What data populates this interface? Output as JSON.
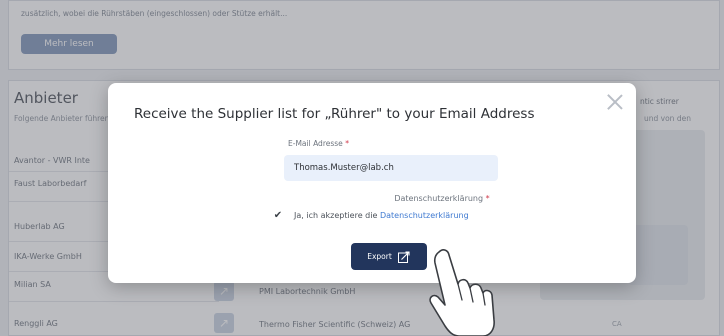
{
  "background": {
    "description_snippet": "zusätzlich, wobei die Rührstäben (eingeschlossen) oder Stütze erhält...",
    "more_button": "Mehr lesen",
    "section_title": "Anbieter",
    "section_subtitle": "Folgende Anbieter führen",
    "right_subtitle": "und von den",
    "right_text": "ntic stirrer",
    "card_caption": "CA",
    "suppliers": [
      "Avantor - VWR Inte",
      "Faust Laborbedarf",
      "Huberlab AG",
      "IKA-Werke GmbH",
      "Milian SA",
      "Renggli AG"
    ],
    "mid_suppliers": [
      "PMI Labortechnik GmbH",
      "Thermo Fisher Scientific (Schweiz) AG"
    ]
  },
  "modal": {
    "title": "Receive the Supplier list for „Rührer\" to your Email Address",
    "email_label": "E-Mail Adresse",
    "required_mark": "*",
    "email_value": "Thomas.Muster@lab.ch",
    "privacy_label": "Datenschutzerklärung",
    "consent_prefix": "Ja, ich akzeptiere die",
    "consent_link": "Datenschutzerklärung",
    "consent_checked": true,
    "export_label": "Export"
  },
  "colors": {
    "primary_button": "#22355c",
    "link": "#3f7ad1",
    "input_bg": "#e9f0fb",
    "required": "#d0384a"
  }
}
